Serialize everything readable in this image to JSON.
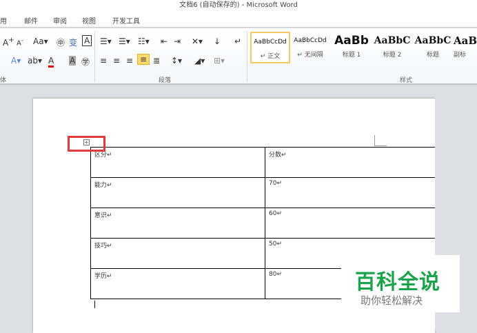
{
  "window": {
    "title": "文档6 (自动保存的) - Microsoft Word"
  },
  "tabs": [
    "用",
    "邮件",
    "审阅",
    "视图",
    "开发工具"
  ],
  "ribbon": {
    "groups": [
      "体",
      "段落",
      "样式"
    ],
    "styles": [
      {
        "preview": "AaBbCcDd",
        "name": "↵ 正文",
        "selected": true
      },
      {
        "preview": "AaBbCcDd",
        "name": "↵ 无间隔"
      },
      {
        "preview": "AaBb",
        "name": "标题 1"
      },
      {
        "preview": "AaBbC",
        "name": "标题 2"
      },
      {
        "preview": "AaBbC",
        "name": "标题"
      },
      {
        "preview": "AaB",
        "name": "副标"
      }
    ]
  },
  "table": {
    "rows": [
      [
        "区分↵",
        "分数↵"
      ],
      [
        "能力↵",
        "70↵"
      ],
      [
        "意识↵",
        "60↵"
      ],
      [
        "技巧↵",
        "50↵"
      ],
      [
        "学历↵",
        "80↵"
      ]
    ]
  },
  "watermark": {
    "title": "百科全说",
    "subtitle": "助你轻松解决"
  }
}
